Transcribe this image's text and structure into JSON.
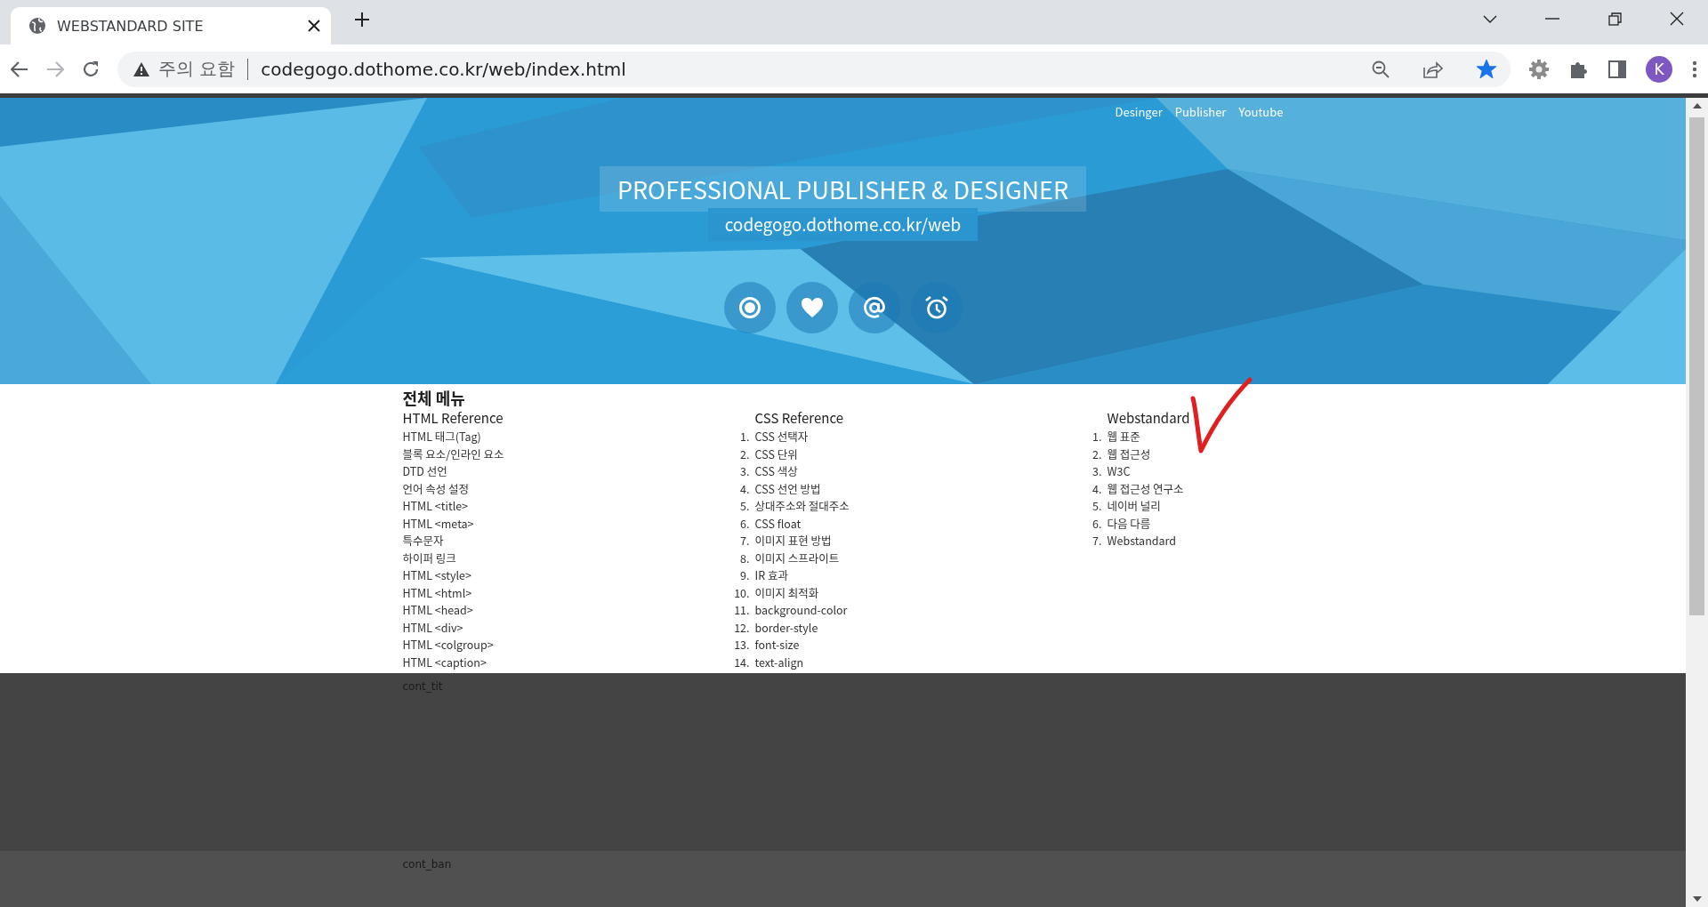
{
  "browser": {
    "tab": {
      "title": "WEBSTANDARD SITE"
    },
    "forward_disabled": true,
    "address": {
      "warning": "주의 요함",
      "url": "codegogo.dothome.co.kr/web/index.html"
    },
    "bookmarked": true,
    "profile_initial": "K"
  },
  "header": {
    "nav": [
      "Desinger",
      "Publisher",
      "Youtube"
    ],
    "title": "PROFESSIONAL PUBLISHER & DESIGNER",
    "subtitle": "codegogo.dothome.co.kr/web",
    "icons": [
      {
        "kind": "record"
      },
      {
        "kind": "heart"
      },
      {
        "kind": "at"
      },
      {
        "kind": "alarm"
      }
    ]
  },
  "menu": {
    "title": "전체 메뉴",
    "columns": [
      {
        "heading": "HTML Reference",
        "items": [
          {
            "label": "HTML 태그(Tag)"
          },
          {
            "label": "블록 요소/인라인 요소"
          },
          {
            "label": "DTD 선언"
          },
          {
            "label": "언어 속성 설정"
          },
          {
            "label": "HTML <title>"
          },
          {
            "label": "HTML <meta>"
          },
          {
            "label": "특수문자"
          },
          {
            "label": "하이퍼 링크"
          },
          {
            "label": "HTML <style>"
          },
          {
            "label": "HTML <html>"
          },
          {
            "label": "HTML <head>"
          },
          {
            "label": "HTML <div>"
          },
          {
            "label": "HTML <colgroup>"
          },
          {
            "label": "HTML <caption>"
          }
        ]
      },
      {
        "heading": "CSS Reference",
        "items": [
          {
            "number": "1.",
            "label": "CSS 선택자"
          },
          {
            "number": "2.",
            "label": "CSS 단위"
          },
          {
            "number": "3.",
            "label": "CSS 색상"
          },
          {
            "number": "4.",
            "label": "CSS 선언 방법"
          },
          {
            "number": "5.",
            "label": "상대주소와 절대주소"
          },
          {
            "number": "6.",
            "label": "CSS float"
          },
          {
            "number": "7.",
            "label": "이미지 표현 방법"
          },
          {
            "number": "8.",
            "label": "이미지 스프라이트"
          },
          {
            "number": "9.",
            "label": "IR 효과"
          },
          {
            "number": "10.",
            "label": "이미지 최적화"
          },
          {
            "number": "11.",
            "label": "background-color"
          },
          {
            "number": "12.",
            "label": "border-style"
          },
          {
            "number": "13.",
            "label": "font-size"
          },
          {
            "number": "14.",
            "label": "text-align"
          }
        ]
      },
      {
        "heading": "Webstandard",
        "items": [
          {
            "number": "1.",
            "label": "웹 표준"
          },
          {
            "number": "2.",
            "label": "웹 접근성"
          },
          {
            "number": "3.",
            "label": "W3C"
          },
          {
            "number": "4.",
            "label": "웹 접근성 연구소"
          },
          {
            "number": "5.",
            "label": "네이버 널리"
          },
          {
            "number": "6.",
            "label": "다음 다름"
          },
          {
            "number": "7.",
            "label": "Webstandard"
          }
        ]
      }
    ]
  },
  "annotation": {
    "kind": "check-mark"
  },
  "sections": [
    {
      "label": "cont_tit"
    },
    {
      "label": "cont_ban"
    }
  ]
}
